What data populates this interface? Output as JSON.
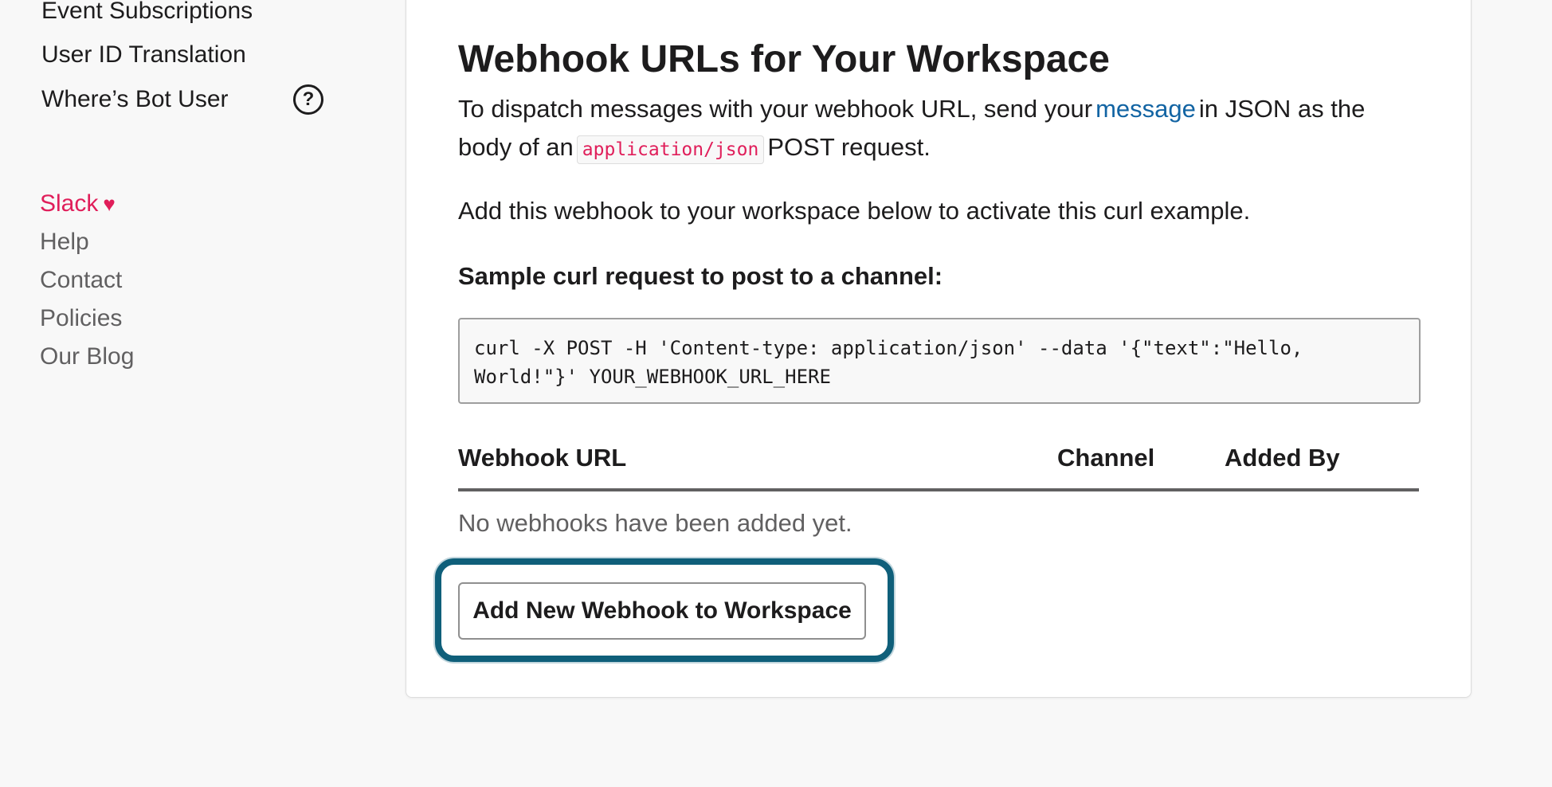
{
  "sidebar": {
    "items": [
      {
        "label": "Event Subscriptions"
      },
      {
        "label": "User ID Translation"
      },
      {
        "label": "Where’s Bot User"
      }
    ],
    "help_icon_glyph": "?",
    "footer_links": [
      {
        "label": "Slack"
      },
      {
        "label": "Help"
      },
      {
        "label": "Contact"
      },
      {
        "label": "Policies"
      },
      {
        "label": "Our Blog"
      }
    ],
    "heart_glyph": "♥"
  },
  "main": {
    "title": "Webhook URLs for Your Workspace",
    "intro": {
      "part1": "To dispatch messages with your webhook URL, send your",
      "link": "message",
      "part2": "in JSON as the body of an",
      "code": "application/json",
      "part3": "POST request."
    },
    "activate_text": "Add this webhook to your workspace below to activate this curl example.",
    "sample_label": "Sample curl request to post to a channel:",
    "curl_example": "curl -X POST -H 'Content-type: application/json' --data '{\"text\":\"Hello, World!\"}' YOUR_WEBHOOK_URL_HERE",
    "table": {
      "columns": [
        "Webhook URL",
        "Channel",
        "Added By"
      ],
      "empty_message": "No webhooks have been added yet."
    },
    "add_button_label": "Add New Webhook to Workspace"
  },
  "colors": {
    "brand_pink": "#e01e5a",
    "link_blue": "#1264a3",
    "focus_teal": "#0f5f7a"
  },
  "icons": {
    "help": "question-circle-icon",
    "heart": "heart-icon"
  }
}
